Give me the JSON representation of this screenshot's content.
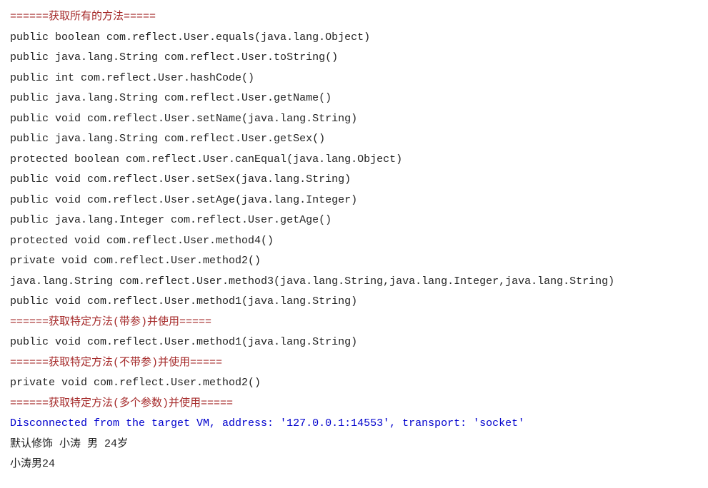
{
  "lines": [
    {
      "cls": "red",
      "text": "======获取所有的方法====="
    },
    {
      "cls": "black",
      "text": "public boolean com.reflect.User.equals(java.lang.Object)"
    },
    {
      "cls": "black",
      "text": "public java.lang.String com.reflect.User.toString()"
    },
    {
      "cls": "black",
      "text": "public int com.reflect.User.hashCode()"
    },
    {
      "cls": "black",
      "text": "public java.lang.String com.reflect.User.getName()"
    },
    {
      "cls": "black",
      "text": "public void com.reflect.User.setName(java.lang.String)"
    },
    {
      "cls": "black",
      "text": "public java.lang.String com.reflect.User.getSex()"
    },
    {
      "cls": "black",
      "text": "protected boolean com.reflect.User.canEqual(java.lang.Object)"
    },
    {
      "cls": "black",
      "text": "public void com.reflect.User.setSex(java.lang.String)"
    },
    {
      "cls": "black",
      "text": "public void com.reflect.User.setAge(java.lang.Integer)"
    },
    {
      "cls": "black",
      "text": "public java.lang.Integer com.reflect.User.getAge()"
    },
    {
      "cls": "black",
      "text": "protected void com.reflect.User.method4()"
    },
    {
      "cls": "black",
      "text": "private void com.reflect.User.method2()"
    },
    {
      "cls": "black",
      "text": "java.lang.String com.reflect.User.method3(java.lang.String,java.lang.Integer,java.lang.String)"
    },
    {
      "cls": "black",
      "text": "public void com.reflect.User.method1(java.lang.String)"
    },
    {
      "cls": "red",
      "text": "======获取特定方法(带参)并使用====="
    },
    {
      "cls": "black",
      "text": "public void com.reflect.User.method1(java.lang.String)"
    },
    {
      "cls": "red",
      "text": "======获取特定方法(不带参)并使用====="
    },
    {
      "cls": "black",
      "text": "private void com.reflect.User.method2()"
    },
    {
      "cls": "red",
      "text": "======获取特定方法(多个参数)并使用====="
    },
    {
      "cls": "blue",
      "text": "Disconnected from the target VM, address: '127.0.0.1:14553', transport: 'socket'"
    },
    {
      "cls": "black",
      "text": "默认修饰 小涛 男 24岁"
    },
    {
      "cls": "black",
      "text": "小涛男24"
    }
  ]
}
